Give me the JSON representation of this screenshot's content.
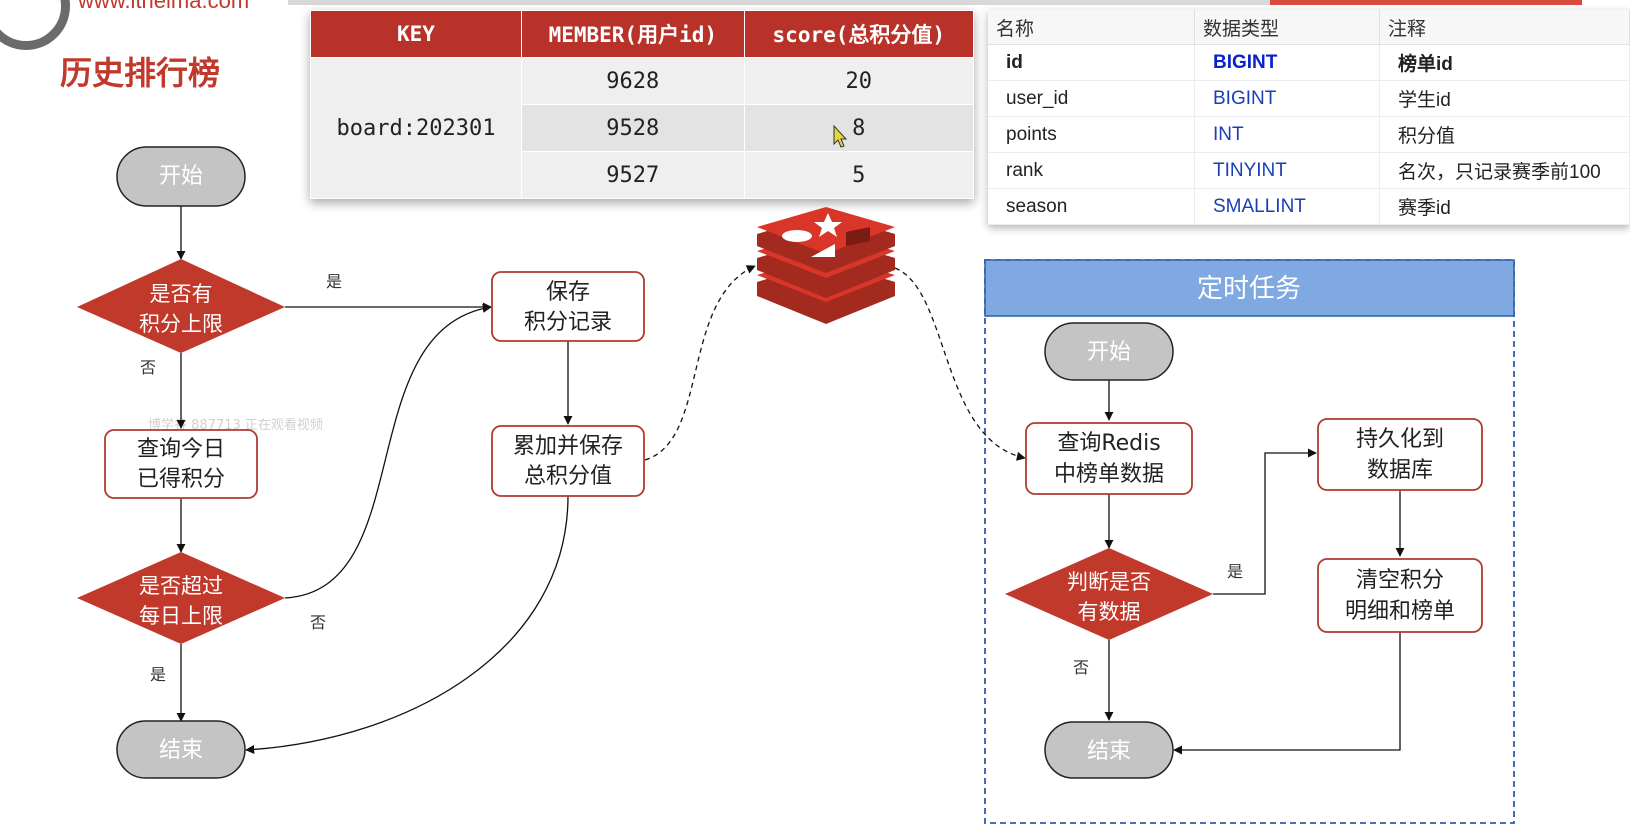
{
  "header": {
    "site": "www.itheima.com",
    "page_title": "历史排行榜",
    "watermark": "博学谷 887713 正在观看视频"
  },
  "redis_table": {
    "headers": [
      "KEY",
      "MEMBER(用户id)",
      "score(总积分值)"
    ],
    "key": "board:202301",
    "rows": [
      {
        "member": "9628",
        "score": "20"
      },
      {
        "member": "9528",
        "score": "8"
      },
      {
        "member": "9527",
        "score": "5"
      }
    ]
  },
  "db_table": {
    "headers": [
      "名称",
      "数据类型",
      "注释"
    ],
    "rows": [
      {
        "name": "id",
        "type": "BIGINT",
        "comment": "榜单id"
      },
      {
        "name": "user_id",
        "type": "BIGINT",
        "comment": "学生id"
      },
      {
        "name": "points",
        "type": "INT",
        "comment": "积分值"
      },
      {
        "name": "rank",
        "type": "TINYINT",
        "comment": "名次，只记录赛季前100"
      },
      {
        "name": "season",
        "type": "SMALLINT",
        "comment": "赛季id"
      }
    ]
  },
  "flow_left": {
    "start": "开始",
    "decision_limit": [
      "是否有",
      "积分上限"
    ],
    "query_today": [
      "查询今日",
      "已得积分"
    ],
    "decision_exceed": [
      "是否超过",
      "每日上限"
    ],
    "end": "结束",
    "save_record": [
      "保存",
      "积分记录"
    ],
    "accumulate": [
      "累加并保存",
      "总积分值"
    ],
    "yes": "是",
    "no": "否"
  },
  "scheduled_task": {
    "title": "定时任务",
    "start": "开始",
    "query_redis": [
      "查询Redis",
      "中榜单数据"
    ],
    "decision_data": [
      "判断是否",
      "有数据"
    ],
    "persist": [
      "持久化到",
      "数据库"
    ],
    "clear": [
      "清空积分",
      "明细和榜单"
    ],
    "end": "结束",
    "yes": "是",
    "no": "否"
  },
  "colors": {
    "brand_red": "#c0392b",
    "diamond_fill": "#c0392b",
    "terminal_fill": "#c4c4c4",
    "box_border": "#b03a2e",
    "task_header": "#7fa9e0",
    "task_border": "#2b5ea8",
    "redis_red": "#d93629",
    "type_blue": "#1a3fb5"
  },
  "icons": [
    "redis-logo-icon",
    "logo-ring-icon"
  ]
}
